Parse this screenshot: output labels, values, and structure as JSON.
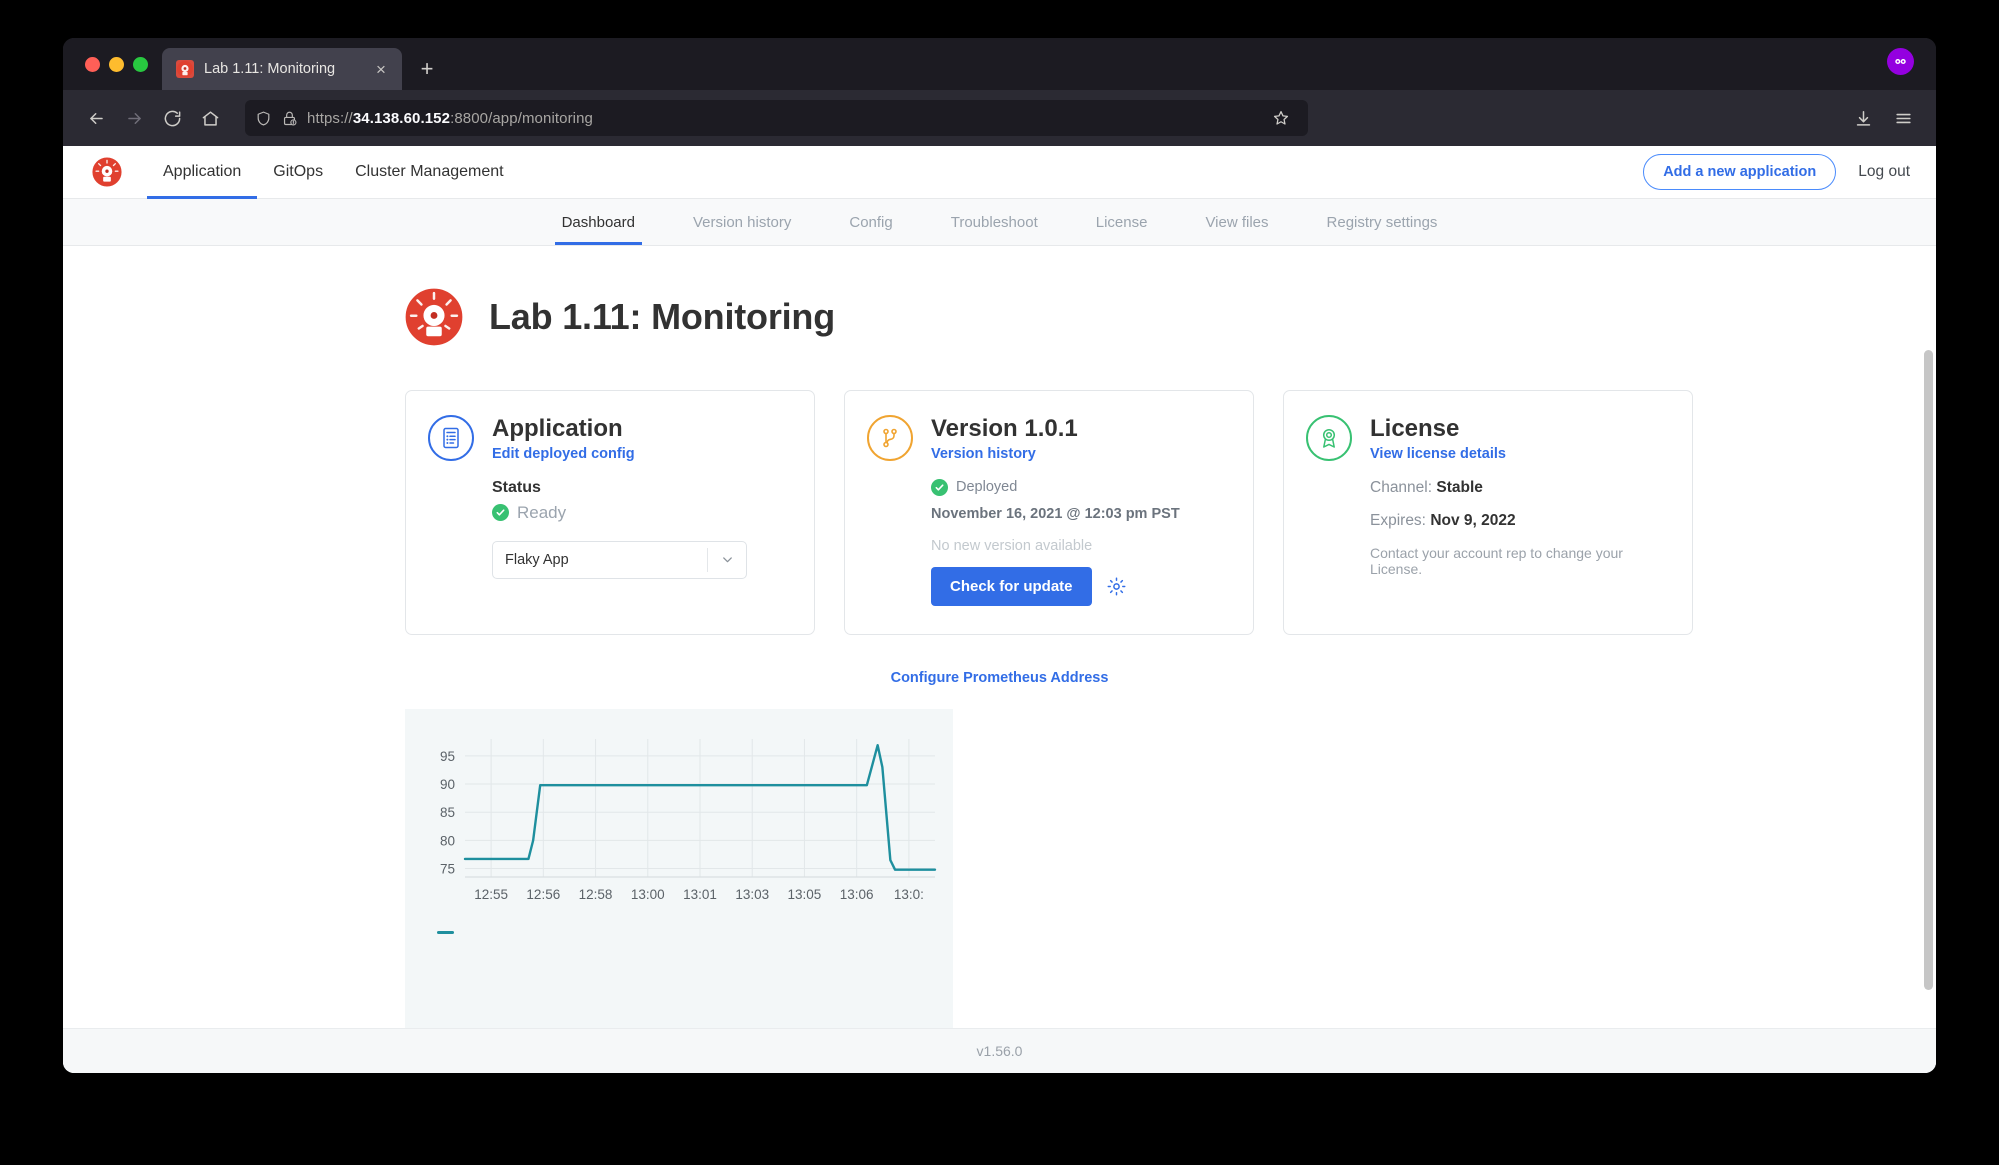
{
  "browser": {
    "tab": {
      "title": "Lab 1.11: Monitoring",
      "favicon": "app-alarm-icon",
      "close": "×"
    },
    "new_tab_label": "+",
    "url": {
      "scheme": "https://",
      "host": "34.138.60.152",
      "rest": ":8800/app/monitoring"
    },
    "nav": {
      "back": "back-arrow-icon",
      "forward": "forward-arrow-icon",
      "reload": "reload-icon",
      "home": "home-icon",
      "shield": "shield-icon",
      "lock_warning": "lock-warning-icon",
      "bookmark": "star-icon",
      "downloads": "download-icon",
      "menu": "hamburger-menu-icon"
    },
    "pocket_badge": "pocket-badge-icon"
  },
  "topnav": {
    "logo": "kots-app-logo",
    "items": [
      {
        "label": "Application",
        "active": true
      },
      {
        "label": "GitOps",
        "active": false
      },
      {
        "label": "Cluster Management",
        "active": false
      }
    ],
    "add_app_button": "Add a new application",
    "logout": "Log out"
  },
  "subnav": {
    "items": [
      {
        "label": "Dashboard",
        "active": true
      },
      {
        "label": "Version history",
        "active": false
      },
      {
        "label": "Config",
        "active": false
      },
      {
        "label": "Troubleshoot",
        "active": false
      },
      {
        "label": "License",
        "active": false
      },
      {
        "label": "View files",
        "active": false
      },
      {
        "label": "Registry settings",
        "active": false
      }
    ]
  },
  "app_header": {
    "logo": "app-alarm-logo",
    "title": "Lab 1.11: Monitoring"
  },
  "cards": {
    "application": {
      "icon": "document-list-icon",
      "title": "Application",
      "link": "Edit deployed config",
      "status_label": "Status",
      "status_icon": "check-circle-icon",
      "status_value": "Ready",
      "select_value": "Flaky App",
      "select_caret": "chevron-down-icon"
    },
    "version": {
      "icon": "git-branch-icon",
      "title": "Version 1.0.1",
      "link": "Version history",
      "deployed_icon": "check-circle-icon",
      "deployed_label": "Deployed",
      "date": "November 16, 2021 @ 12:03 pm PST",
      "no_new_version": "No new version available",
      "check_button": "Check for update",
      "gear_icon": "gear-icon"
    },
    "license": {
      "icon": "license-ribbon-icon",
      "title": "License",
      "link": "View license details",
      "channel_label": "Channel:",
      "channel_value": "Stable",
      "expires_label": "Expires:",
      "expires_value": "Nov 9, 2022",
      "note": "Contact your account rep to change your License."
    }
  },
  "prometheus": {
    "configure_link": "Configure Prometheus Address"
  },
  "chart_data": {
    "type": "line",
    "title": "",
    "xlabel": "",
    "ylabel": "",
    "x_ticks": [
      "12:55",
      "12:56",
      "12:58",
      "13:00",
      "13:01",
      "13:03",
      "13:05",
      "13:06",
      "13:0:"
    ],
    "y_ticks": [
      75,
      80,
      85,
      90,
      95
    ],
    "ylim": [
      73.5,
      98
    ],
    "grid": true,
    "legend_position": "below-left",
    "series": [
      {
        "name": "",
        "color": "#1e8f9e",
        "x": [
          0,
          0.1,
          0.135,
          0.145,
          0.16,
          0.5,
          0.855,
          0.878,
          0.888,
          0.905,
          0.915,
          1.0
        ],
        "values": [
          76.7,
          76.7,
          76.7,
          80.0,
          89.8,
          89.8,
          89.8,
          96.9,
          93.0,
          76.5,
          74.8,
          74.8
        ]
      }
    ]
  },
  "footer": {
    "version": "v1.56.0"
  }
}
